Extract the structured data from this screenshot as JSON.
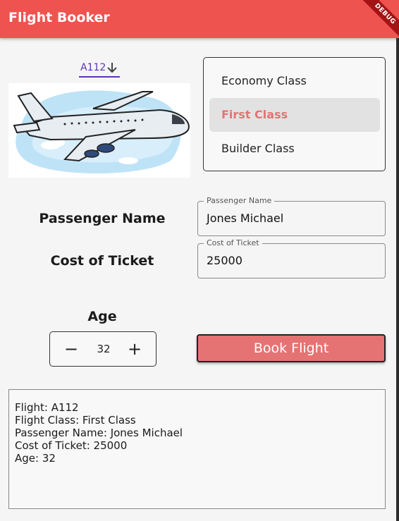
{
  "appbar": {
    "title": "Flight Booker",
    "banner": "DEBUG",
    "color": "#ef5350"
  },
  "flight_dropdown": {
    "selected": "A112",
    "icon": "arrow-down-icon"
  },
  "classes": {
    "items": [
      {
        "label": "Economy Class",
        "selected": false
      },
      {
        "label": "First Class",
        "selected": true
      },
      {
        "label": "Builder Class",
        "selected": false
      }
    ]
  },
  "form": {
    "passenger_label": "Passenger Name",
    "passenger_field_label": "Passenger Name",
    "passenger_value": "Jones Michael",
    "cost_label": "Cost of Ticket",
    "cost_field_label": "Cost of Ticket",
    "cost_value": "25000",
    "age_label": "Age",
    "age_value": "32",
    "decrement_symbol": "−",
    "increment_symbol": "+"
  },
  "book_button": {
    "label": "Book Flight",
    "color": "#e57373"
  },
  "summary": {
    "lines": [
      "Flight: A112",
      "Flight Class: First Class",
      "Passenger Name: Jones Michael",
      "Cost of Ticket: 25000",
      "Age: 32"
    ]
  }
}
